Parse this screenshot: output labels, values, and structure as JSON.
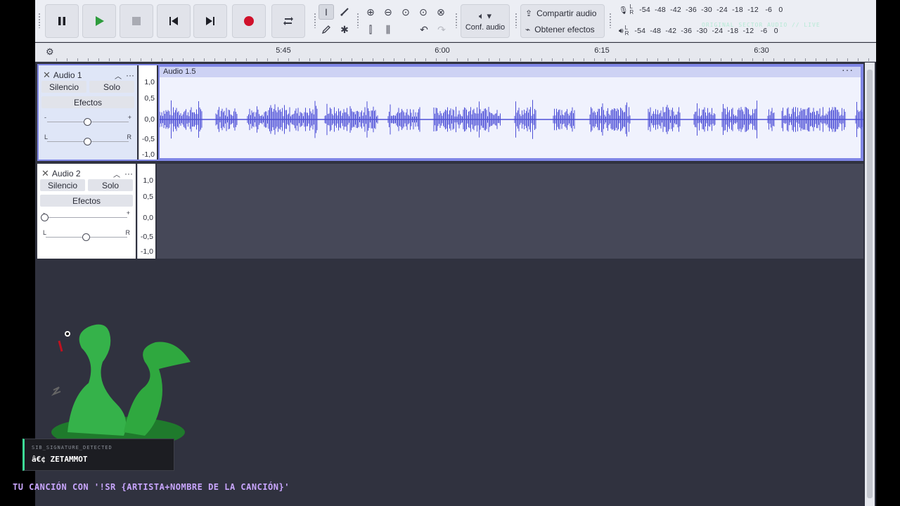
{
  "transport": {
    "pause": "pause-icon",
    "play": "play-icon",
    "stop": "stop-icon",
    "skip_start": "skip-start-icon",
    "skip_end": "skip-end-icon",
    "record": "record-icon",
    "loop": "loop-icon"
  },
  "audio_setup": {
    "label": "Conf. audio"
  },
  "share": {
    "share_label": "Compartir audio",
    "effects_label": "Obtener efectos"
  },
  "meters": {
    "record_scale": "-54  -48  -42  -36  -30  -24  -18  -12   -6   0",
    "play_scale": "-54  -48  -42  -36  -30  -24  -18  -12   -6   0",
    "L": "L",
    "R": "R"
  },
  "ruler": {
    "ticks": [
      "5:45",
      "6:00",
      "6:15",
      "6:30"
    ]
  },
  "tracks": [
    {
      "name": "Audio 1",
      "mute": "Silencio",
      "solo": "Solo",
      "effects": "Efectos",
      "gain_minus": "-",
      "gain_plus": "+",
      "pan_left": "L",
      "pan_right": "R",
      "gain_level": 0.5,
      "pan_level": 0.5,
      "clip_name": "Audio 1.5",
      "scale": [
        "1,0",
        "0,5",
        "0,0",
        "-0,5",
        "-1,0"
      ]
    },
    {
      "name": "Audio 2",
      "mute": "Silencio",
      "solo": "Solo",
      "effects": "Efectos",
      "gain_minus": "-",
      "gain_plus": "+",
      "pan_left": "L",
      "pan_right": "R",
      "gain_level": 0.0,
      "pan_level": 0.5,
      "scale": [
        "1,0",
        "0,5",
        "0,0",
        "-0,5",
        "-1,0"
      ]
    }
  ],
  "overlay": {
    "small": "SIB_SIGNATURE_DETECTED",
    "name": "â€¢ ZETAMMOT",
    "caption": "TU CANCIÓN CON '!SR {ARTISTA+NOMBRE DE LA CANCIÓN}'",
    "watermark": "ORIGINAL SECTOR AUDIO // LIVE"
  },
  "colors": {
    "waveform": "#4d4fd6",
    "clip_border": "#7f86e6",
    "record": "#d0112b",
    "play": "#2e9c3d"
  }
}
